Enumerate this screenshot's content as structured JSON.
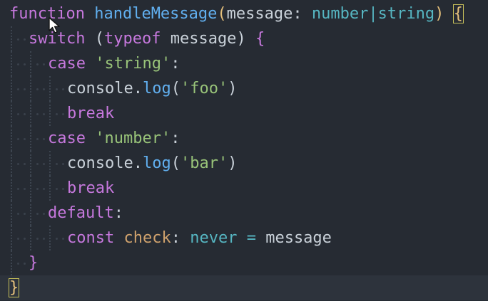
{
  "editor": {
    "lines": [
      {
        "indent": 0,
        "tokens": [
          {
            "t": "function",
            "c": "kw"
          },
          {
            "t": " ",
            "c": "plain"
          },
          {
            "t": "handleMessage",
            "c": "fn"
          },
          {
            "t": "(",
            "c": "paren"
          },
          {
            "t": "message",
            "c": "plain"
          },
          {
            "t": ": ",
            "c": "plain"
          },
          {
            "t": "number",
            "c": "type"
          },
          {
            "t": "|",
            "c": "op"
          },
          {
            "t": "string",
            "c": "type"
          },
          {
            "t": ") ",
            "c": "paren"
          },
          {
            "t": "{",
            "c": "bracket-match"
          }
        ]
      },
      {
        "indent": 1,
        "tokens": [
          {
            "t": "switch",
            "c": "kw"
          },
          {
            "t": " (",
            "c": "plain"
          },
          {
            "t": "typeof",
            "c": "kw"
          },
          {
            "t": " message",
            "c": "plain"
          },
          {
            "t": ") ",
            "c": "plain"
          },
          {
            "t": "{",
            "c": "brace-purple"
          }
        ]
      },
      {
        "indent": 2,
        "tokens": [
          {
            "t": "case",
            "c": "kw"
          },
          {
            "t": " ",
            "c": "plain"
          },
          {
            "t": "'string'",
            "c": "str"
          },
          {
            "t": ":",
            "c": "plain"
          }
        ]
      },
      {
        "indent": 3,
        "tokens": [
          {
            "t": "console",
            "c": "plain"
          },
          {
            "t": ".",
            "c": "plain"
          },
          {
            "t": "log",
            "c": "fn"
          },
          {
            "t": "(",
            "c": "plain"
          },
          {
            "t": "'foo'",
            "c": "str"
          },
          {
            "t": ")",
            "c": "plain"
          }
        ]
      },
      {
        "indent": 3,
        "tokens": [
          {
            "t": "break",
            "c": "kw"
          }
        ]
      },
      {
        "indent": 2,
        "tokens": [
          {
            "t": "case",
            "c": "kw"
          },
          {
            "t": " ",
            "c": "plain"
          },
          {
            "t": "'number'",
            "c": "str"
          },
          {
            "t": ":",
            "c": "plain"
          }
        ]
      },
      {
        "indent": 3,
        "tokens": [
          {
            "t": "console",
            "c": "plain"
          },
          {
            "t": ".",
            "c": "plain"
          },
          {
            "t": "log",
            "c": "fn"
          },
          {
            "t": "(",
            "c": "plain"
          },
          {
            "t": "'bar'",
            "c": "str"
          },
          {
            "t": ")",
            "c": "plain"
          }
        ]
      },
      {
        "indent": 3,
        "tokens": [
          {
            "t": "break",
            "c": "kw"
          }
        ]
      },
      {
        "indent": 2,
        "tokens": [
          {
            "t": "default",
            "c": "kw"
          },
          {
            "t": ":",
            "c": "plain"
          }
        ]
      },
      {
        "indent": 3,
        "tokens": [
          {
            "t": "const",
            "c": "kw"
          },
          {
            "t": " ",
            "c": "plain"
          },
          {
            "t": "check",
            "c": "var"
          },
          {
            "t": ": ",
            "c": "plain"
          },
          {
            "t": "never",
            "c": "type"
          },
          {
            "t": " = ",
            "c": "op"
          },
          {
            "t": "message",
            "c": "plain"
          }
        ]
      },
      {
        "indent": 1,
        "tokens": [
          {
            "t": "}",
            "c": "brace-purple"
          }
        ]
      },
      {
        "indent": 0,
        "active": true,
        "tokens": [
          {
            "t": "}",
            "c": "bracket-match"
          }
        ]
      }
    ]
  },
  "icons": {
    "cursor": "mouse-pointer-icon"
  },
  "colors": {
    "background": "#262b33",
    "keyword": "#c678dd",
    "function": "#61afef",
    "type": "#56b6c2",
    "string": "#98c379",
    "variable": "#d0a26d",
    "text": "#c9d1d9"
  }
}
